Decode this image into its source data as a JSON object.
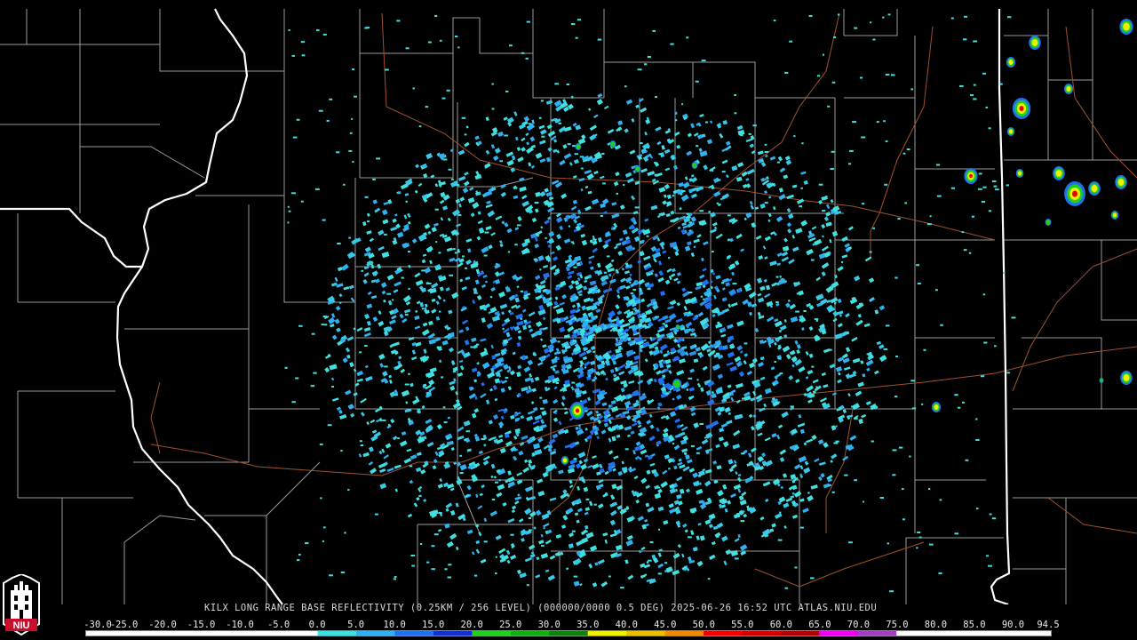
{
  "header": {
    "caption": "KILX LONG RANGE BASE REFLECTIVITY (0.25KM / 256 LEVEL) (000000/0000 0.5 DEG) 2025-06-26 16:52 UTC  ATLAS.NIU.EDU"
  },
  "logo": {
    "text": "NIU",
    "icon": "niu-tower-logo-icon",
    "color": "#c8102e"
  },
  "legend": {
    "ticks": [
      "-30.0",
      "-25.0",
      "-20.0",
      "-15.0",
      "-10.0",
      "-5.0",
      "0.0",
      "5.0",
      "10.0",
      "15.0",
      "20.0",
      "25.0",
      "30.0",
      "35.0",
      "40.0",
      "45.0",
      "50.0",
      "55.0",
      "60.0",
      "65.0",
      "70.0",
      "75.0",
      "80.0",
      "85.0",
      "90.0",
      "94.5"
    ],
    "colors": [
      "#ffffff",
      "#ffffff",
      "#ffffff",
      "#ffffff",
      "#ffffff",
      "#ffffff",
      "#40e0e0",
      "#30b0f0",
      "#2070f0",
      "#1030d0",
      "#20d020",
      "#10b010",
      "#108010",
      "#f0f000",
      "#e8c000",
      "#f08800",
      "#f00000",
      "#d00000",
      "#b00000",
      "#f000f0",
      "#a040c0",
      "#ffffff",
      "#ffffff",
      "#ffffff",
      "#ffffff"
    ]
  },
  "map": {
    "radar_site": "KILX",
    "colors": {
      "background": "#000000",
      "county": "#9a9a9a",
      "state": "#ffffff",
      "road": "#a0522d"
    }
  }
}
